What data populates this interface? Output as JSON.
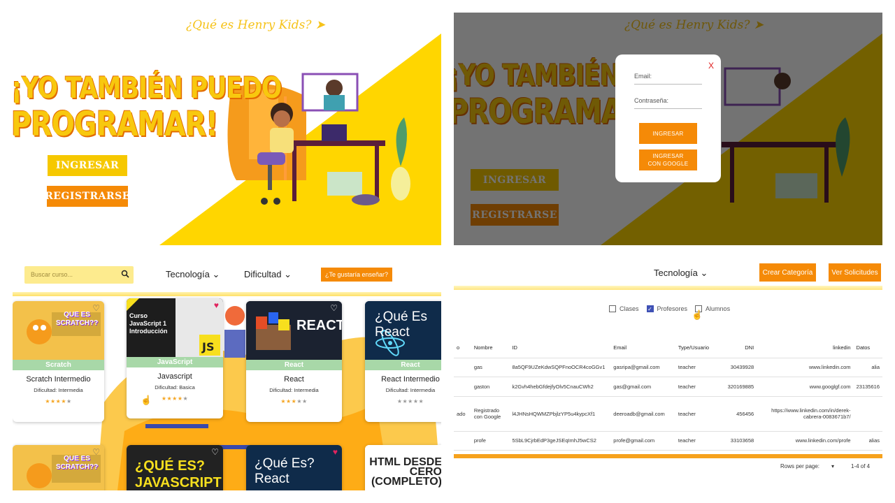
{
  "landing": {
    "tagline": "¿Qué es Henry Kids?",
    "hero_line1": "¡YO TAMBIÉN PUEDO",
    "hero_line2": "PROGRAMAR!",
    "login_label": "INGRESAR",
    "register_label": "REGISTRARSE"
  },
  "login_modal": {
    "close": "X",
    "email_placeholder": "Email:",
    "password_placeholder": "Contraseña:",
    "login_button": "INGRESAR",
    "google_button_line1": "INGRESAR",
    "google_button_line2": "CON GOOGLE"
  },
  "catalog": {
    "search_placeholder": "Buscar curso...",
    "technology_dropdown": "Tecnología",
    "difficulty_dropdown": "Dificultad",
    "teach_button": "¿Te gustaría enseñar?",
    "cards": [
      {
        "band": "Scratch",
        "name": "Scratch Intermedio",
        "difficulty": "Dificultad: Intermedia",
        "stars": 4,
        "favorite": false,
        "thumb_text": "QUE ES SCRATCH??"
      },
      {
        "band": "JavaScript",
        "name": "Javascript",
        "difficulty": "Dificultad: Basica",
        "stars": 4,
        "favorite": true,
        "thumb_text": "Curso JavaScript 1 Introducción"
      },
      {
        "band": "React",
        "name": "React",
        "difficulty": "Dificultad: Intermedia",
        "stars": 3,
        "favorite": false,
        "thumb_text": "REACT"
      },
      {
        "band": "React",
        "name": "React Intermedio",
        "difficulty": "Dificultad: Intermedia",
        "stars": 0,
        "favorite": false,
        "thumb_text": "¿Qué Es React"
      },
      {
        "thumb_text": "QUE ES SCRATCH??",
        "favorite": false
      },
      {
        "thumb_text": "¿QUÉ ES? JAVASCRIPT",
        "favorite": false
      },
      {
        "thumb_text": "¿Qué Es? React",
        "favorite": true
      },
      {
        "thumb_text": "HTML DESDE CERO (COMPLETO)",
        "favorite": false
      }
    ]
  },
  "admin": {
    "technology_dropdown": "Tecnología",
    "create_category": "Crear Categoría",
    "view_requests": "Ver Solicitudes",
    "filters": [
      {
        "label": "Clases",
        "checked": false
      },
      {
        "label": "Profesores",
        "checked": true
      },
      {
        "label": "Alumnos",
        "checked": false
      }
    ],
    "columns": [
      "o",
      "Nombre",
      "ID",
      "Email",
      "Type/Usuario",
      "DNI",
      "linkedin",
      "Datos"
    ],
    "rows": [
      [
        "",
        "gas",
        "8a5QF9UZeKdwSQPFnoOCR4coGGv1",
        "gasripa@gmail.com",
        "teacher",
        "30439928",
        "www.linkedin.com",
        "alia"
      ],
      [
        "",
        "gaston",
        "k2Gvh4hebGfdejfyOlv5CnauCWh2",
        "gas@gmail.com",
        "teacher",
        "320169885",
        "www.googlgf.com",
        "23135616"
      ],
      [
        "ado",
        "Registrado con Google",
        "l4JHNsHQWMZPbjlzYP5u4kypcXf1",
        "deeroadb@gmail.com",
        "teacher",
        "456456",
        "https://www.linkedin.com/in/derek-cabrera-0083671b7/",
        ""
      ],
      [
        "",
        "profe",
        "5SbL9CjrbEdP3geJSEqImhJ5wCS2",
        "profe@gmail.com",
        "teacher",
        "33103658",
        "www.linkedin.com/profe",
        "alias"
      ]
    ],
    "rows_per_page_label": "Rows per page:",
    "page_range": "1-4 of 4"
  },
  "colors": {
    "yellow": "#f6c800",
    "orange": "#f58a07",
    "checkbox": "#3f51b5"
  }
}
